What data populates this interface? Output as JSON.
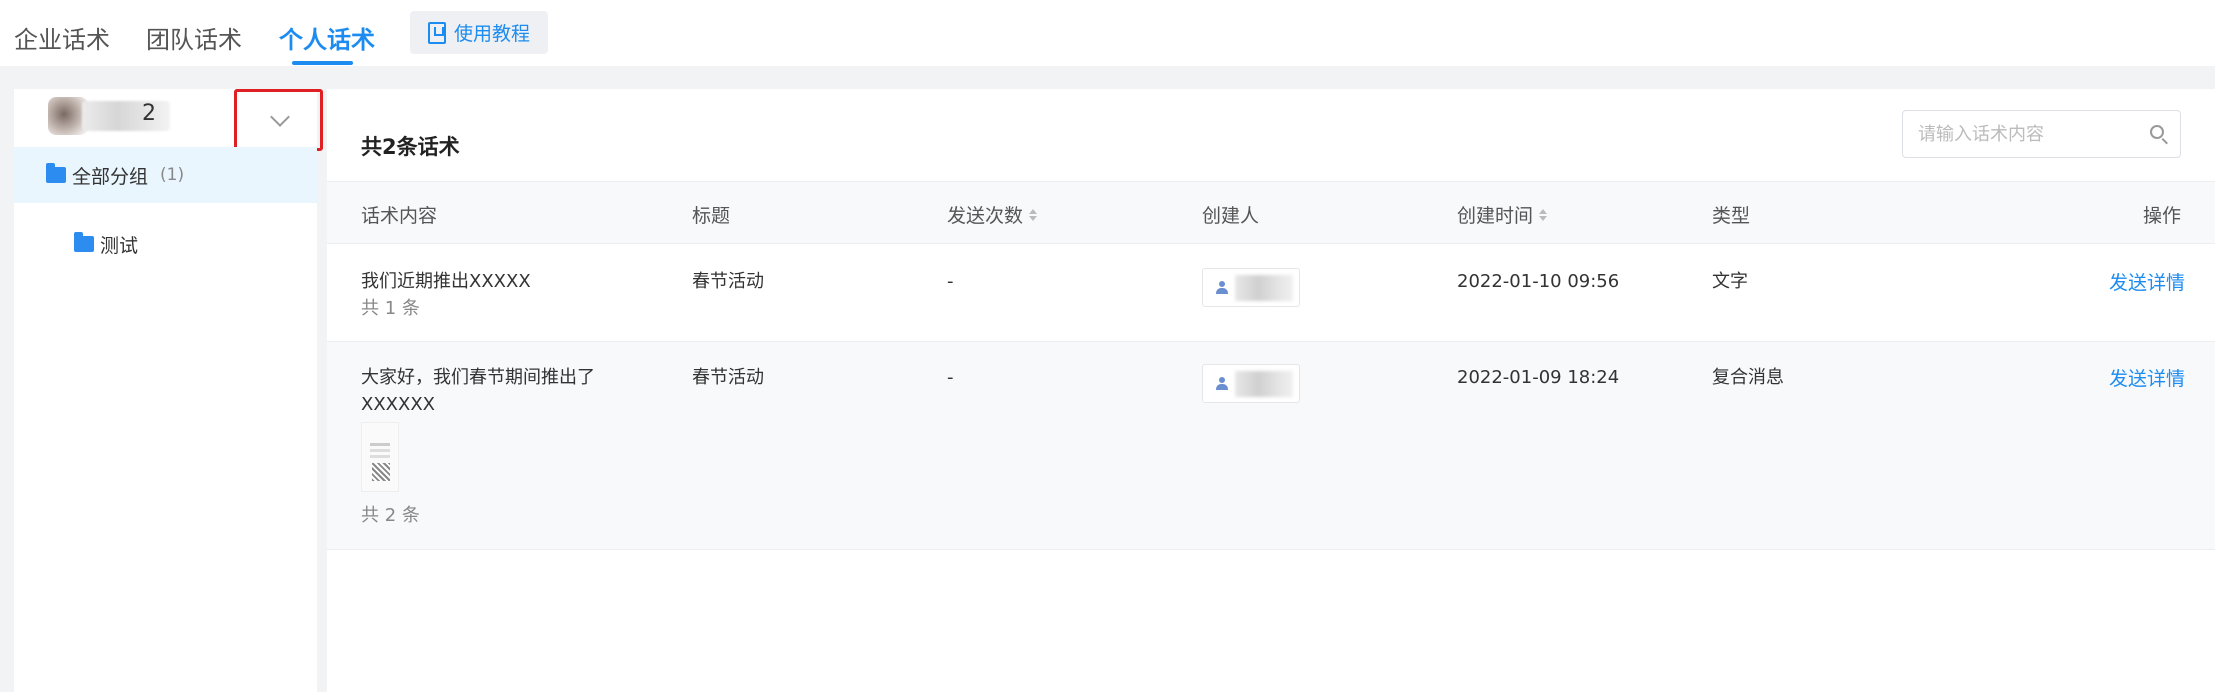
{
  "tabs": {
    "enterprise": "企业话术",
    "team": "团队话术",
    "personal": "个人话术",
    "tutorial": "使用教程"
  },
  "sidebar": {
    "user_name_tail": "2",
    "groups": [
      {
        "label": "全部分组",
        "count": "(1)"
      },
      {
        "label": "测试"
      }
    ]
  },
  "main": {
    "total_title": "共2条话术",
    "search_placeholder": "请输入话术内容",
    "columns": {
      "content": "话术内容",
      "title": "标题",
      "send_count": "发送次数",
      "creator": "创建人",
      "created_time": "创建时间",
      "type": "类型",
      "action": "操作"
    },
    "rows": [
      {
        "content_line1": "我们近期推出XXXXX",
        "content_line2": "",
        "count_label": "共 1 条",
        "title": "春节活动",
        "send_count": "-",
        "created_time": "2022-01-10 09:56",
        "type": "文字",
        "action": "发送详情"
      },
      {
        "content_line1": "大家好，我们春节期间推出了",
        "content_line2": "XXXXXX",
        "count_label": "共 2 条",
        "title": "春节活动",
        "send_count": "-",
        "created_time": "2022-01-09 18:24",
        "type": "复合消息",
        "action": "发送详情"
      }
    ]
  },
  "colors": {
    "accent": "#1d8cf0",
    "highlight_border": "#e01f24",
    "selected_group_bg": "#eaf6fe"
  }
}
